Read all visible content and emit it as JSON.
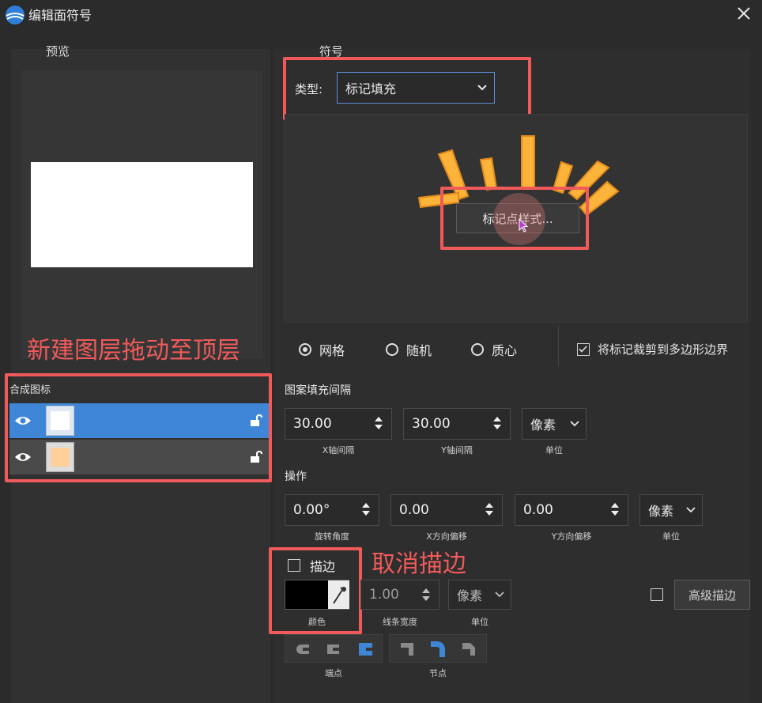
{
  "window": {
    "title": "编辑面符号"
  },
  "preview": {
    "label": "预览"
  },
  "symbol": {
    "label": "符号",
    "type_label": "类型:",
    "type_value": "标记填充",
    "marker_style_button": "标记点样式..."
  },
  "placement": {
    "options": [
      {
        "label": "网格",
        "selected": true
      },
      {
        "label": "随机",
        "selected": false
      },
      {
        "label": "质心",
        "selected": false
      }
    ],
    "clip_label": "将标记裁剪到多边形边界",
    "clip_checked": true
  },
  "spacing": {
    "title": "图案填充间隔",
    "x_value": "30.00",
    "x_caption": "X轴间隔",
    "y_value": "30.00",
    "y_caption": "Y轴间隔",
    "unit_value": "像素",
    "unit_caption": "单位"
  },
  "operation": {
    "title": "操作",
    "rotation_value": "0.00°",
    "rotation_caption": "旋转角度",
    "xoffset_value": "0.00",
    "xoffset_caption": "X方向偏移",
    "yoffset_value": "0.00",
    "yoffset_caption": "Y方向偏移",
    "unit_value": "像素",
    "unit_caption": "单位"
  },
  "stroke": {
    "label": "描边",
    "checked": false,
    "color_caption": "颜色",
    "color": "#000000",
    "width_value": "1.00",
    "width_caption": "线条宽度",
    "unit_value": "像素",
    "unit_caption": "单位",
    "advanced_label": "高级描边",
    "advanced_checked": false,
    "endpoint_caption": "端点",
    "joint_caption": "节点"
  },
  "layers": {
    "title": "合成图标",
    "items": [
      {
        "swatch": "#ffffff",
        "selected": true
      },
      {
        "swatch": "#ffcf99",
        "selected": false
      }
    ]
  },
  "annotations": {
    "drag_note": "新建图层拖动至顶层",
    "stroke_note": "取消描边"
  },
  "colors": {
    "accent_red": "#f05a5a",
    "selected_row": "#3f86d6",
    "burst": "#fbb33a"
  }
}
